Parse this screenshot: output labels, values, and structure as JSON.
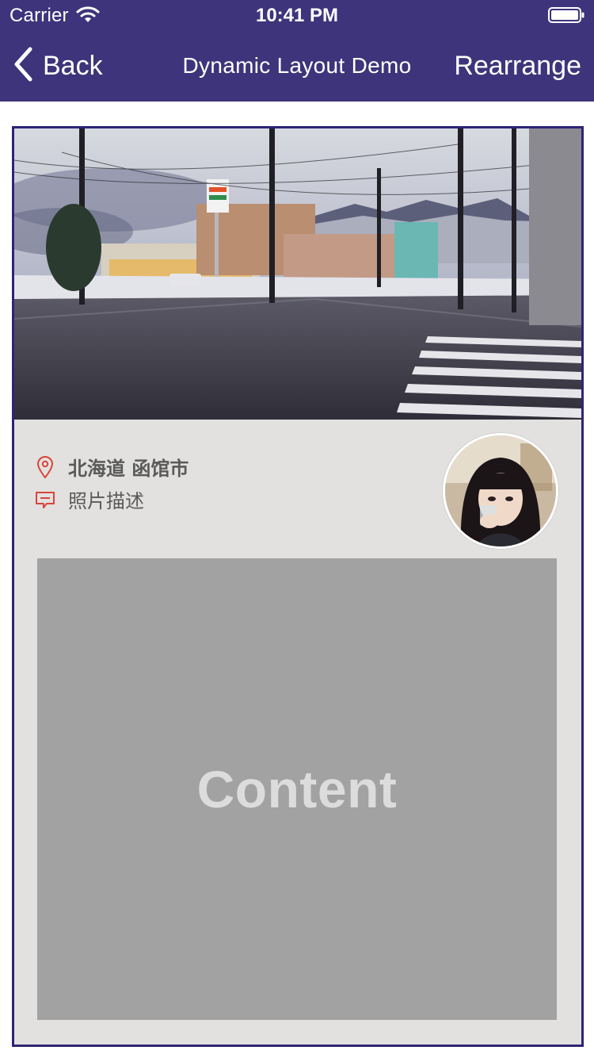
{
  "status_bar": {
    "carrier": "Carrier",
    "time": "10:41 PM",
    "wifi_icon": "wifi-icon",
    "battery_icon": "battery-icon"
  },
  "nav": {
    "back_label": "Back",
    "back_icon": "chevron-left-icon",
    "title": "Dynamic Layout Demo",
    "action_label": "Rearrange"
  },
  "card": {
    "location": "北海道 函馆市",
    "location_icon": "map-pin-icon",
    "description": "照片描述",
    "description_icon": "comment-icon",
    "content_label": "Content"
  },
  "colors": {
    "nav_background": "#3e347b",
    "card_border": "#2d2475",
    "card_background": "#e2e1e0",
    "content_background": "#a2a2a2",
    "icon_red": "#d9453a"
  }
}
